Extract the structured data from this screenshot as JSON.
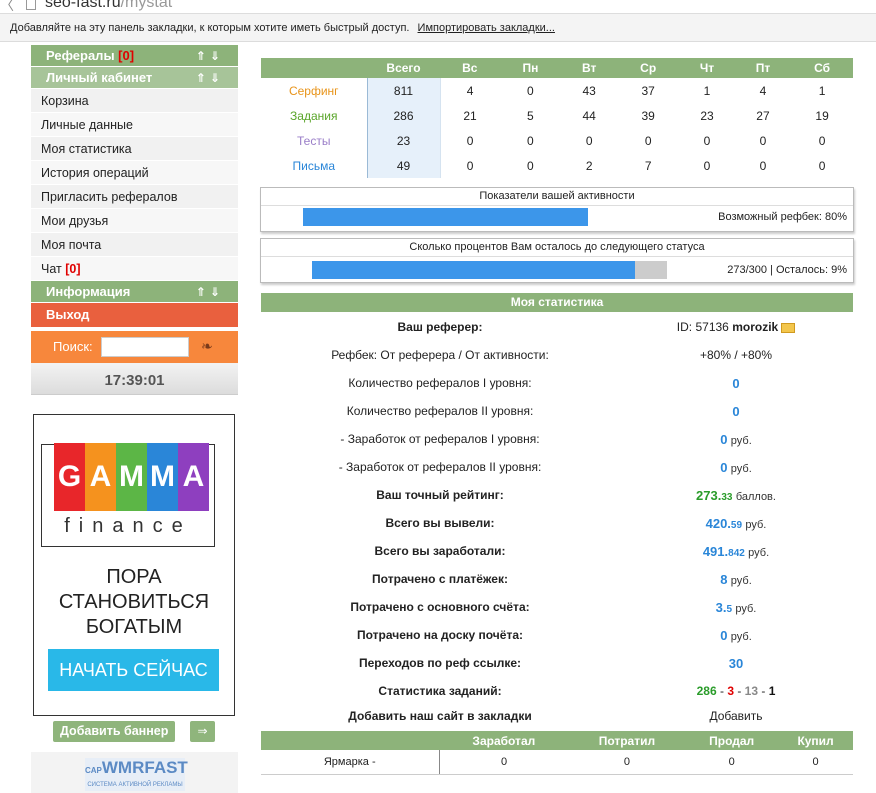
{
  "browser": {
    "url_host": "seo-fast.ru",
    "url_path": "/mystat",
    "bookmarks_hint": "Добавляйте на эту панель закладки, к которым хотите иметь быстрый доступ.",
    "import_link": "Импортировать закладки..."
  },
  "sidebar": {
    "referrals_label": "Рефералы",
    "referrals_count": "[0]",
    "cabinet_label": "Личный кабинет",
    "items": [
      "Корзина",
      "Личные данные",
      "Моя статистика",
      "История операций",
      "Пригласить рефералов",
      "Мои друзья",
      "Моя почта"
    ],
    "chat_label": "Чат",
    "chat_count": "[0]",
    "info_label": "Информация",
    "exit_label": "Выход",
    "search_label": "Поиск:",
    "search_value": "",
    "clock": "17:39:01"
  },
  "banner": {
    "letters": [
      "G",
      "A",
      "M",
      "M",
      "A"
    ],
    "letter_colors": [
      "#e8262a",
      "#f5921e",
      "#5cb646",
      "#2a86d8",
      "#8e3fbf"
    ],
    "finance": "finance",
    "slogan": [
      "ПОРА",
      "СТАНОВИТЬСЯ",
      "БОГАТЫМ"
    ],
    "cta": "НАЧАТЬ СЕЙЧАС",
    "add_banner": "Добавить баннер",
    "add_arrow": "⇒",
    "partner_logo": "WMRFAST",
    "partner_logo_prefix": "CAP",
    "partner_sub": "СИСТЕМА АКТИВНОЙ РЕКЛАМЫ"
  },
  "days_table": {
    "columns": [
      "Всего",
      "Вс",
      "Пн",
      "Вт",
      "Ср",
      "Чт",
      "Пт",
      "Сб"
    ],
    "rows": [
      {
        "name": "Серфинг",
        "color": "#e8941a",
        "values": [
          "811",
          "4",
          "0",
          "43",
          "37",
          "1",
          "4",
          "1"
        ]
      },
      {
        "name": "Задания",
        "color": "#5aa52a",
        "values": [
          "286",
          "21",
          "5",
          "44",
          "39",
          "23",
          "27",
          "19"
        ]
      },
      {
        "name": "Тесты",
        "color": "#9a7ec8",
        "values": [
          "23",
          "0",
          "0",
          "0",
          "0",
          "0",
          "0",
          "0"
        ]
      },
      {
        "name": "Письма",
        "color": "#2a86d8",
        "values": [
          "49",
          "0",
          "0",
          "2",
          "7",
          "0",
          "0",
          "0"
        ]
      }
    ]
  },
  "activity": {
    "title": "Показатели вашей активности",
    "note": "Возможный рефбек: 80%",
    "progress": 0.8
  },
  "status": {
    "title": "Сколько процентов Вам осталось до следующего статуса",
    "note": "273/300 | Осталось: 9%",
    "progress": 0.91
  },
  "stats": {
    "title": "Моя статистика",
    "referrer_label": "Ваш реферер:",
    "referrer_id": "ID: 57136",
    "referrer_name": "morozik",
    "refback_label": "Рефбек: От реферера / От активности:",
    "refback_value": "+80% / +80%",
    "ref1_label": "Количество рефералов I уровня:",
    "ref1_value": "0",
    "ref2_label": "Количество рефералов II уровня:",
    "ref2_value": "0",
    "earn1_label": "- Заработок от рефералов I уровня:",
    "earn1_value": "0",
    "earn2_label": "- Заработок от рефералов II уровня:",
    "earn2_value": "0",
    "rating_label": "Ваш точный рейтинг:",
    "rating_int": "273.",
    "rating_dec": "33",
    "rating_unit": "баллов.",
    "withdrawn_label": "Всего вы вывели:",
    "withdrawn_int": "420.",
    "withdrawn_dec": "59",
    "earned_label": "Всего вы заработали:",
    "earned_int": "491.",
    "earned_dec": "842",
    "spent_pay_label": "Потрачено с платёжек:",
    "spent_pay_value": "8",
    "spent_main_label": "Потрачено с основного счёта:",
    "spent_main_int": "3.",
    "spent_main_dec": "5",
    "spent_board_label": "Потрачено на доску почёта:",
    "spent_board_value": "0",
    "clicks_label": "Переходов по реф ссылке:",
    "clicks_value": "30",
    "tasks_label": "Статистика заданий:",
    "tasks_green": "286",
    "tasks_red": "3",
    "tasks_gray": "13",
    "tasks_black": "1",
    "sep": " - ",
    "bookmark_label": "Добавить наш сайт в закладки",
    "bookmark_action": "Добавить",
    "currency": "руб."
  },
  "market": {
    "columns": [
      "Заработал",
      "Потратил",
      "Продал",
      "Купил"
    ],
    "row_name": "Ярмарка -",
    "values": [
      "0",
      "0",
      "0",
      "0"
    ]
  }
}
